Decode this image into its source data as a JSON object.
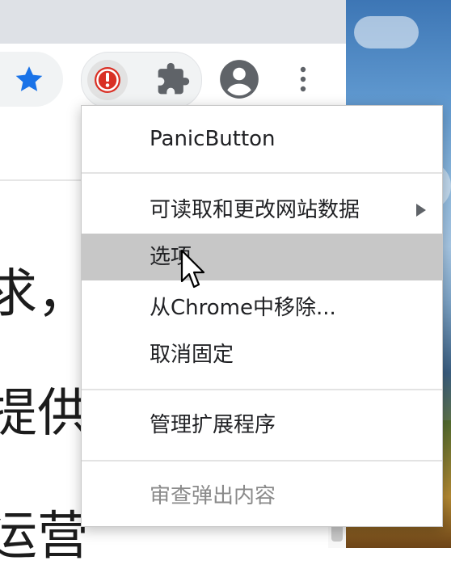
{
  "toolbar": {
    "bookmark_icon": "star-icon",
    "extension_icon": "panic-button-icon",
    "extensions_menu_icon": "puzzle-icon",
    "profile_icon": "account-circle-icon",
    "more_icon": "three-dots-vertical-icon",
    "accent_color": "#1a73e8",
    "panic_color": "#d93025"
  },
  "page": {
    "lines": [
      "求，",
      "提供",
      "运营"
    ]
  },
  "context_menu": {
    "extension_name": "PanicButton",
    "items": [
      {
        "label": "可读取和更改网站数据",
        "has_submenu": true,
        "state": "normal"
      },
      {
        "label": "选项",
        "has_submenu": false,
        "state": "hover"
      },
      {
        "label": "从Chrome中移除...",
        "has_submenu": false,
        "state": "normal"
      },
      {
        "label": "取消固定",
        "has_submenu": false,
        "state": "normal"
      },
      {
        "label": "管理扩展程序",
        "has_submenu": false,
        "state": "normal"
      },
      {
        "label": "审查弹出内容",
        "has_submenu": false,
        "state": "disabled"
      }
    ]
  }
}
